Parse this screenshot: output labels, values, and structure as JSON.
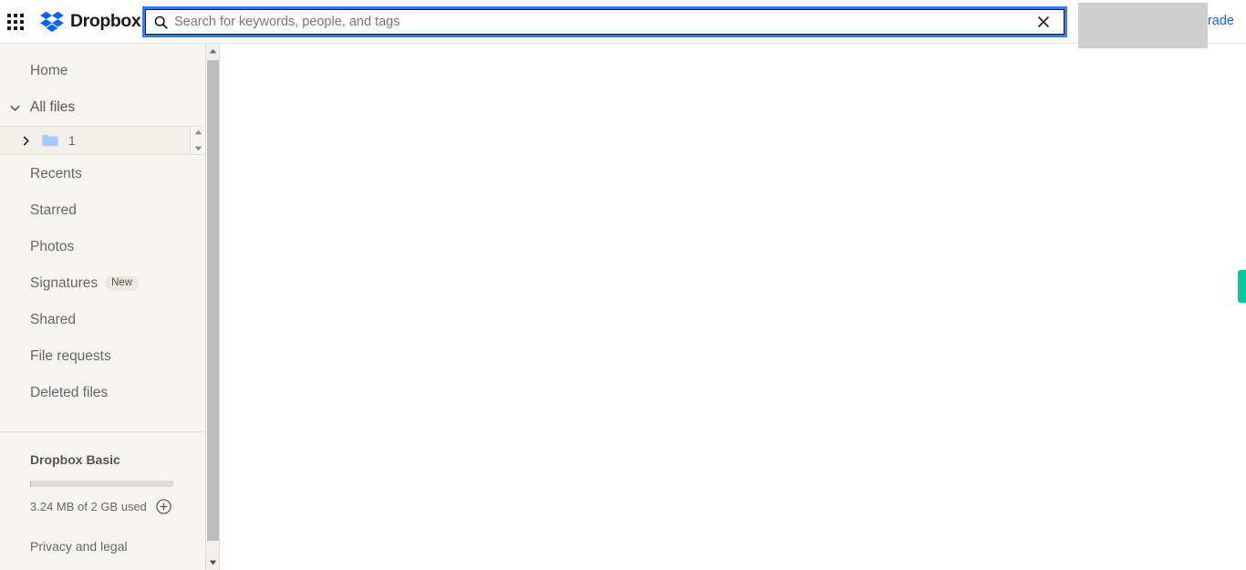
{
  "header": {
    "apps_icon": "apps-grid-icon",
    "brand_name": "Dropbox",
    "brand_logo_icon": "dropbox-logo-icon",
    "upgrade_label": "rade",
    "upgrade_color": "#1964e8"
  },
  "search": {
    "icon": "search-icon",
    "value": "",
    "placeholder": "Search for keywords, people, and tags",
    "clear_icon": "close-icon",
    "focus_border_color": "#3b7af7"
  },
  "sidebar": {
    "items": [
      {
        "label": "Home",
        "icon": null
      },
      {
        "label": "All files",
        "icon": "chevron-down-icon"
      },
      {
        "label": "Recents",
        "icon": null
      },
      {
        "label": "Starred",
        "icon": null
      },
      {
        "label": "Photos",
        "icon": null
      },
      {
        "label": "Signatures",
        "icon": null,
        "badge": "New"
      },
      {
        "label": "Shared",
        "icon": null
      },
      {
        "label": "File requests",
        "icon": null
      },
      {
        "label": "Deleted files",
        "icon": null
      }
    ],
    "folder_tree": {
      "chevron_icon": "chevron-right-icon",
      "folder_icon": "folder-icon",
      "label": "1",
      "scroll_up_icon": "triangle-up-icon",
      "scroll_down_icon": "triangle-down-icon"
    },
    "plan": {
      "title": "Dropbox Basic",
      "usage": "3.24 MB of 2 GB used",
      "add_icon": "plus-circle-icon",
      "progress_percent": 0.16
    },
    "privacy_label": "Privacy and legal",
    "background_color": "#f7f5f2"
  },
  "scrollbar": {
    "up_icon": "triangle-up-icon",
    "down_icon": "triangle-down-icon",
    "thumb_color": "#bdbdbd"
  },
  "edge_tab": {
    "name": "feedback-tab",
    "color": "#00c9a0"
  }
}
